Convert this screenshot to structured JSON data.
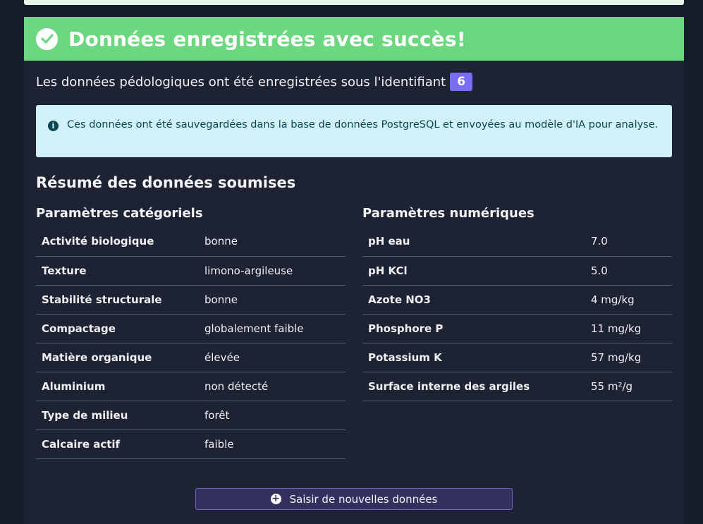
{
  "banner": {
    "title": "Données enregistrées avec succès!",
    "icon": "check-circle-icon",
    "color": "#6bd77e"
  },
  "saved": {
    "text": "Les données pédologiques ont été enregistrées sous l'identifiant",
    "id": "6"
  },
  "alert": {
    "icon": "info-icon",
    "text": "Ces données ont été sauvegardées dans la base de données PostgreSQL et envoyées au modèle d'IA pour analyse."
  },
  "summary": {
    "title": "Résumé des données soumises",
    "categorical": {
      "title": "Paramètres catégoriels",
      "rows": [
        {
          "key": "Activité biologique",
          "value": "bonne"
        },
        {
          "key": "Texture",
          "value": "limono-argileuse"
        },
        {
          "key": "Stabilité structurale",
          "value": "bonne"
        },
        {
          "key": "Compactage",
          "value": "globalement faible"
        },
        {
          "key": "Matière organique",
          "value": "élevée"
        },
        {
          "key": "Aluminium",
          "value": "non détecté"
        },
        {
          "key": "Type de milieu",
          "value": "forêt"
        },
        {
          "key": "Calcaire actif",
          "value": "faible"
        }
      ]
    },
    "numeric": {
      "title": "Paramètres numériques",
      "rows": [
        {
          "key": "pH eau",
          "value": "7.0"
        },
        {
          "key": "pH KCl",
          "value": "5.0"
        },
        {
          "key": "Azote NO3",
          "value": "4 mg/kg"
        },
        {
          "key": "Phosphore P",
          "value": "11 mg/kg"
        },
        {
          "key": "Potassium K",
          "value": "57 mg/kg"
        },
        {
          "key": "Surface interne des argiles",
          "value": "55 m²/g"
        }
      ]
    }
  },
  "actions": {
    "new_data_label": "Saisir de nouvelles données",
    "new_data_icon": "plus-circle-icon",
    "accent": "#7b6cf6"
  }
}
